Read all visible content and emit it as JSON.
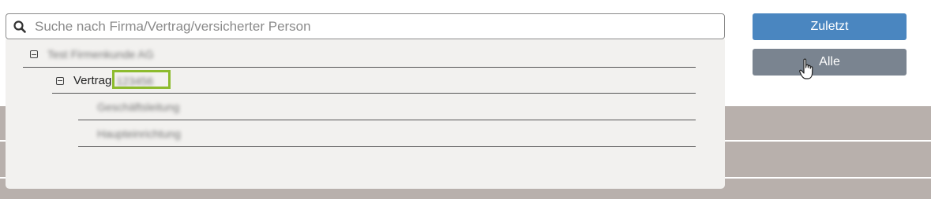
{
  "search": {
    "placeholder": "Suche nach Firma/Vertrag/versicherter Person",
    "value": ""
  },
  "buttons": {
    "recent_label": "Zuletzt",
    "all_label": "Alle"
  },
  "tree": {
    "company_label": "Test Firmenkunde AG",
    "contract_label": "Vertrag",
    "contract_number": "123456",
    "children": [
      "Geschäftsleitung",
      "Haupteinrichtung"
    ]
  },
  "colors": {
    "accent_blue": "#4a86c0",
    "button_gray": "#7a8490",
    "highlight_green": "#8dbb2e",
    "band": "#b8b0ac"
  }
}
